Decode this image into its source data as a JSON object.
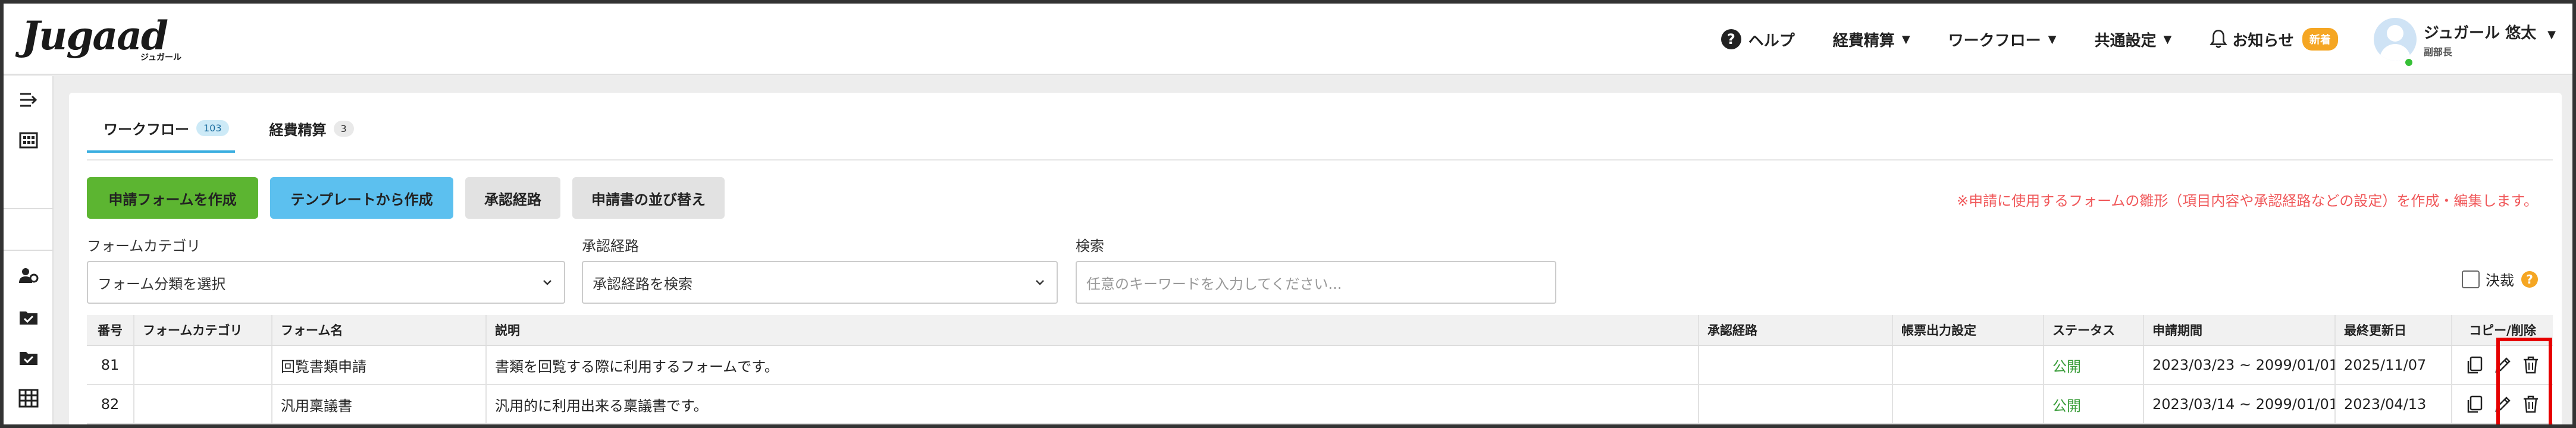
{
  "app": {
    "logo_text": "Jugaad",
    "logo_subtext": "ジュガール"
  },
  "topnav": {
    "help": "ヘルプ",
    "expense": "経費精算",
    "workflow": "ワークフロー",
    "common_settings": "共通設定",
    "notifications": "お知らせ",
    "new_badge": "新着",
    "user_name": "ジュガール 悠太",
    "user_role": "副部長"
  },
  "tabs": [
    {
      "label": "ワークフロー",
      "count": "103",
      "active": true
    },
    {
      "label": "経費精算",
      "count": "3",
      "active": false
    }
  ],
  "buttons": {
    "create_form": "申請フォームを作成",
    "from_template": "テンプレートから作成",
    "approval_route": "承認経路",
    "reorder": "申請書の並び替え"
  },
  "notice": "※申請に使用するフォームの雛形（項目内容や承認経路などの設定）を作成・編集します。",
  "filters": {
    "category_label": "フォームカテゴリ",
    "category_value": "フォーム分類を選択",
    "route_label": "承認経路",
    "route_value": "承認経路を検索",
    "search_label": "検索",
    "search_placeholder": "任意のキーワードを入力してください..."
  },
  "decision_label": "決裁",
  "table": {
    "headers": {
      "no": "番号",
      "category": "フォームカテゴリ",
      "name": "フォーム名",
      "desc": "説明",
      "route": "承認経路",
      "output": "帳票出力設定",
      "status": "ステータス",
      "period": "申請期間",
      "updated": "最終更新日",
      "copy_delete": "コピー/削除"
    },
    "rows": [
      {
        "no": "81",
        "category": "",
        "name": "回覧書類申請",
        "desc": "書類を回覧する際に利用するフォームです。",
        "route": "",
        "output": "",
        "status": "公開",
        "period": "2023/03/23 ~ 2099/01/01",
        "updated": "2025/11/07"
      },
      {
        "no": "82",
        "category": "",
        "name": "汎用稟議書",
        "desc": "汎用的に利用出来る稟議書です。",
        "route": "",
        "output": "",
        "status": "公開",
        "period": "2023/03/14 ~ 2099/01/01",
        "updated": "2023/04/13"
      }
    ]
  },
  "colors": {
    "accent_blue": "#5cc0ef",
    "primary_green": "#5cb531",
    "status_green": "#3a9d3a",
    "notice_red": "#f0585a",
    "highlight_red": "#e60000",
    "badge_orange": "#f5a623"
  }
}
